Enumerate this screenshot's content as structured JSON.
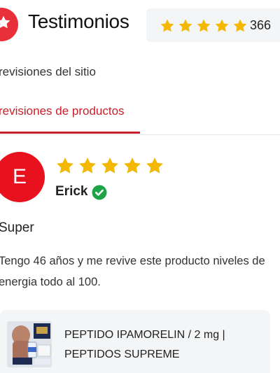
{
  "header": {
    "title": "Testimonios",
    "rating_count": "366",
    "rating_stars": 5,
    "accent_color": "#e8303a",
    "star_color": "#f5b800"
  },
  "tabs": [
    {
      "label": "revisiones del sitio",
      "active": false
    },
    {
      "label": "revisiones de productos",
      "active": true
    }
  ],
  "review": {
    "avatar_letter": "E",
    "stars": 5,
    "reviewer": "Erick",
    "verified": true,
    "title": "Super",
    "body": "Tengo 46 años y me revive este producto niveles de energia todo al 100."
  },
  "product": {
    "name": "PEPTIDO IPAMORELIN / 2 mg | PEPTIDOS SUPREME"
  }
}
